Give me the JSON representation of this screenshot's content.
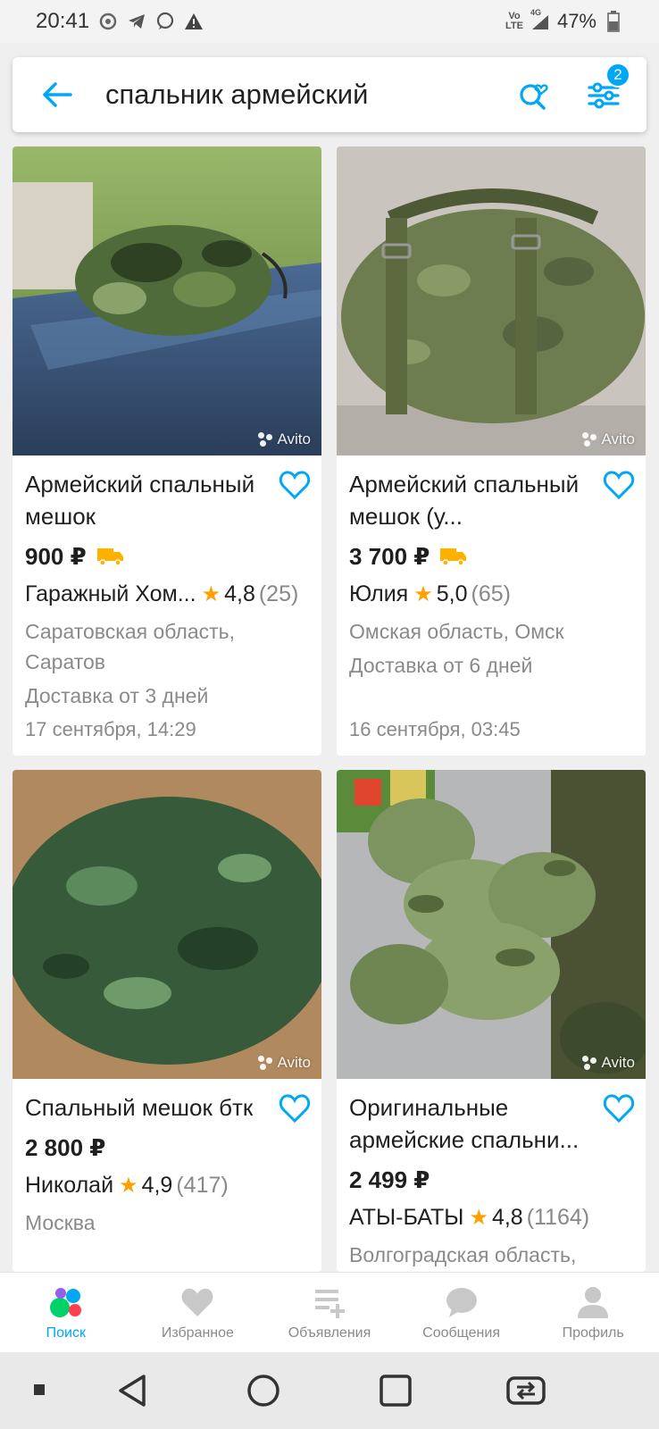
{
  "status_bar": {
    "time": "20:41",
    "network_label_top": "Vo",
    "network_label_bottom": "LTE",
    "network_type": "4G",
    "battery": "47%"
  },
  "search": {
    "query": "спальник армейский",
    "filter_count": "2"
  },
  "listings": [
    {
      "title": "Армейский спальный мешок",
      "price": "900 ₽",
      "delivery_badge": true,
      "seller": "Гаражный Хом...",
      "rating": "4,8",
      "reviews": "(25)",
      "location": "Саратовская область, Саратов",
      "delivery": "Доставка от 3 дней",
      "date": "17 сентября, 14:29",
      "watermark": "Avito"
    },
    {
      "title": "Армейский спальный мешок (у...",
      "price": "3 700 ₽",
      "delivery_badge": true,
      "seller": "Юлия",
      "rating": "5,0",
      "reviews": "(65)",
      "location": "Омская область, Омск",
      "delivery": "Доставка от 6 дней",
      "date": "16 сентября, 03:45",
      "watermark": "Avito"
    },
    {
      "title": "Спальный мешок бтк",
      "price": "2 800 ₽",
      "delivery_badge": false,
      "seller": "Николай",
      "rating": "4,9",
      "reviews": "(417)",
      "location": "Москва",
      "watermark": "Avito"
    },
    {
      "title": "Оригинальные армейские спальни...",
      "price": "2 499 ₽",
      "delivery_badge": false,
      "seller": "АТЫ-БАТЫ",
      "rating": "4,8",
      "reviews": "(1164)",
      "location": "Волгоградская область,",
      "watermark": "Avito"
    }
  ],
  "bottom_nav": [
    {
      "label": "Поиск",
      "icon": "avito-dots-icon",
      "active": true
    },
    {
      "label": "Избранное",
      "icon": "heart-icon",
      "active": false
    },
    {
      "label": "Объявления",
      "icon": "add-list-icon",
      "active": false
    },
    {
      "label": "Сообщения",
      "icon": "chat-icon",
      "active": false
    },
    {
      "label": "Профиль",
      "icon": "person-icon",
      "active": false
    }
  ],
  "colors": {
    "accent": "#00a7f5",
    "star": "#ffa000",
    "delivery": "#ffb000"
  }
}
